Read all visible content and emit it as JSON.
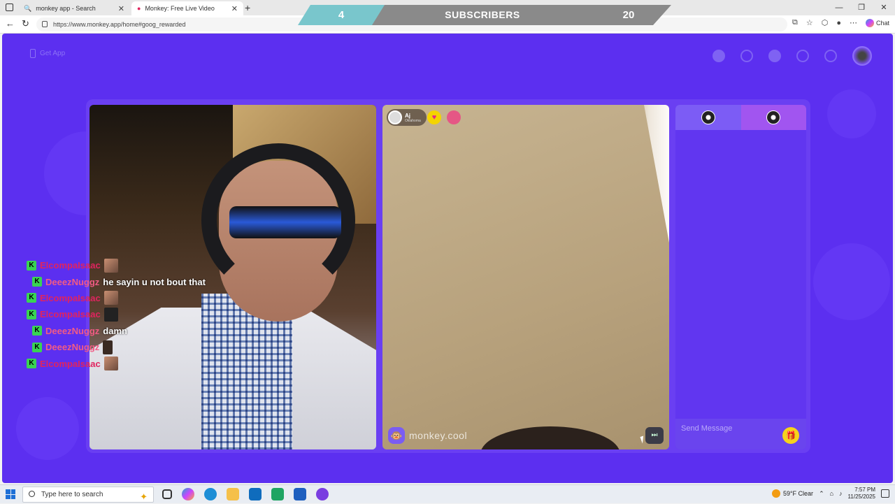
{
  "browser": {
    "tabs": [
      {
        "title": "monkey app - Search",
        "active": false
      },
      {
        "title": "Monkey: Free Live Video Châ",
        "active": true
      }
    ],
    "url": "https://www.monkey.app/home#goog_rewarded",
    "chat_label": "Chat"
  },
  "subscribers": {
    "left_value": "4",
    "label": "SUBSCRIBERS",
    "right_value": "20"
  },
  "app": {
    "get_app_label": "Get App",
    "remote_user": {
      "name": "Aj",
      "location": "Oklahoma"
    },
    "watermark": "monkey.cool",
    "message_placeholder": "Send Message",
    "colors": {
      "background": "#5c2ff0",
      "accent": "#7c5cf5",
      "gift": "#f6d21c"
    }
  },
  "chat_overlay": [
    {
      "user": "ElcompaIsaac",
      "message": "",
      "emote": true,
      "color": "red"
    },
    {
      "user": "DeeezNuggz",
      "message": "he sayin u not bout that",
      "emote": false,
      "color": "pink"
    },
    {
      "user": "ElcompaIsaac",
      "message": "",
      "emote": true,
      "color": "red"
    },
    {
      "user": "ElcompaIsaac",
      "message": "",
      "emote": true,
      "color": "red"
    },
    {
      "user": "DeeezNuggz",
      "message": "damn",
      "emote": false,
      "color": "pink"
    },
    {
      "user": "DeeezNuggz",
      "message": "",
      "emote": true,
      "color": "pink"
    },
    {
      "user": "ElcompaIsaac",
      "message": "",
      "emote": true,
      "color": "red"
    }
  ],
  "taskbar": {
    "search_placeholder": "Type here to search",
    "weather": "59°F  Clear",
    "time": "7:57 PM",
    "date": "11/25/2025"
  }
}
